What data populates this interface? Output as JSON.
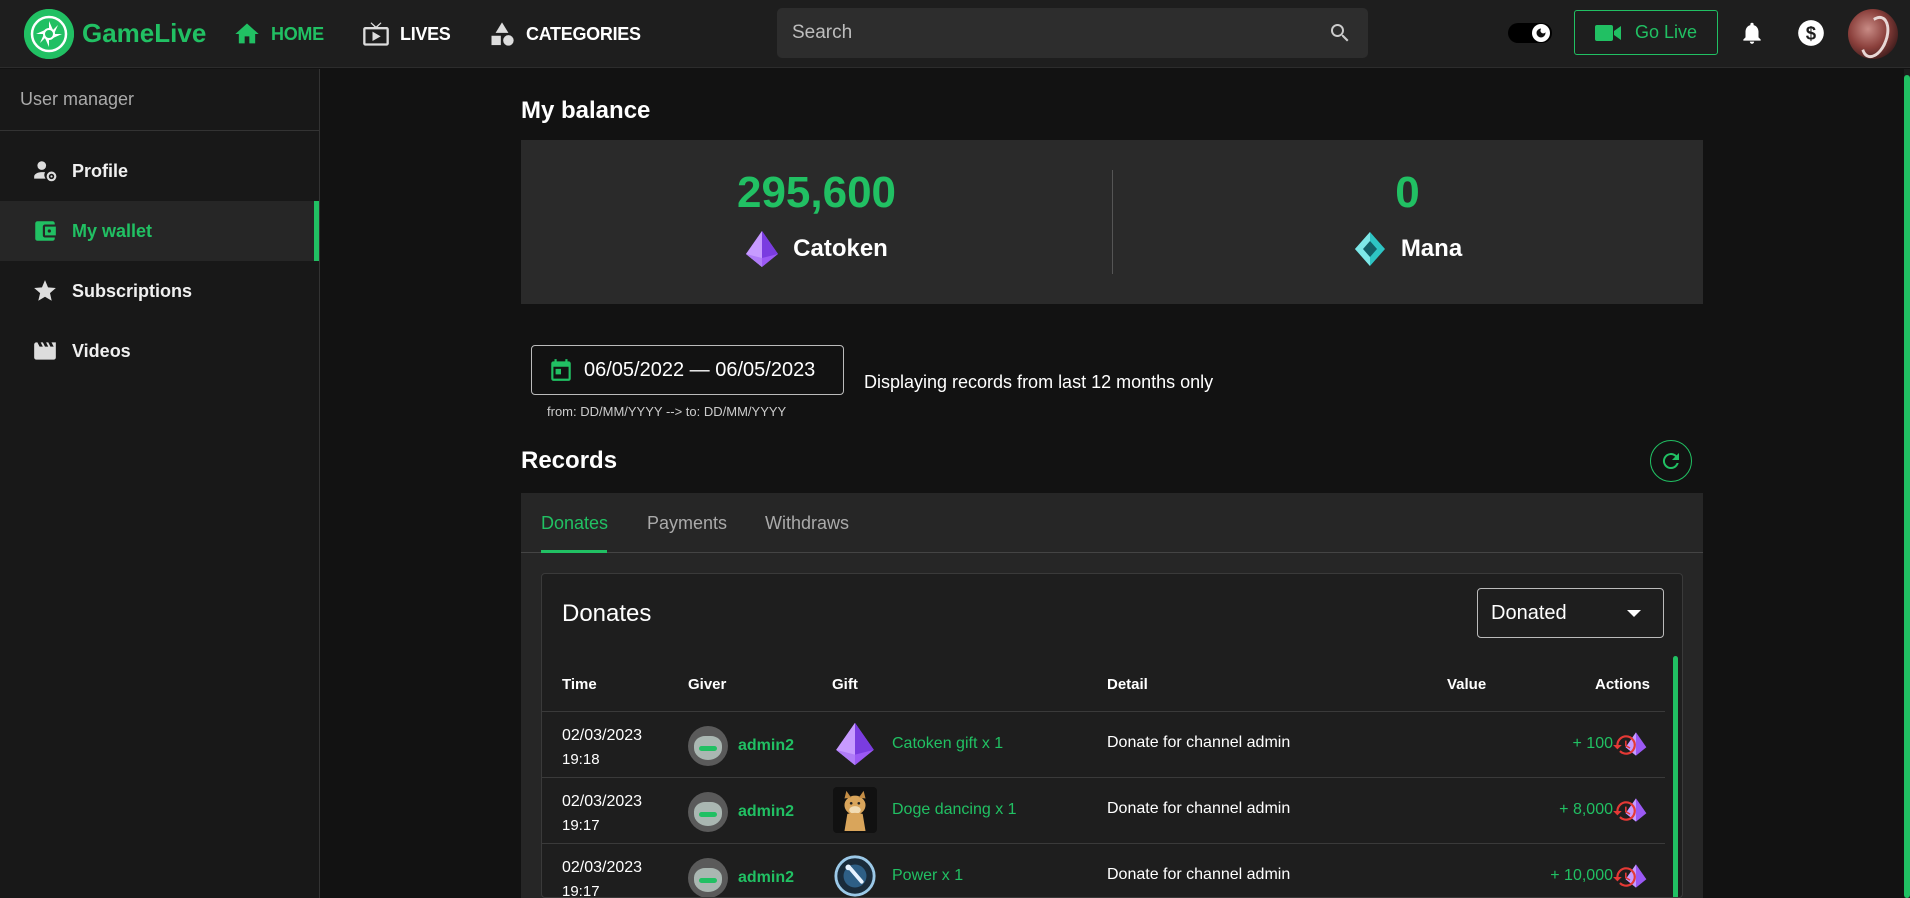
{
  "app": {
    "name": "GameLive"
  },
  "nav": [
    {
      "label": "HOME",
      "icon": "home-icon",
      "active": true
    },
    {
      "label": "LIVES",
      "icon": "tv-icon",
      "active": false
    },
    {
      "label": "CATEGORIES",
      "icon": "shapes-icon",
      "active": false
    }
  ],
  "search": {
    "placeholder": "Search",
    "value": ""
  },
  "header": {
    "go_live_label": "Go Live"
  },
  "colors": {
    "accent": "#21c063",
    "danger": "#e53935",
    "catoken": "#a855f7",
    "mana": "#2ec4c4"
  },
  "sidebar": {
    "heading": "User manager",
    "items": [
      {
        "label": "Profile",
        "icon": "user-gear-icon",
        "active": false
      },
      {
        "label": "My wallet",
        "icon": "wallet-icon",
        "active": true
      },
      {
        "label": "Subscriptions",
        "icon": "star-icon",
        "active": false
      },
      {
        "label": "Videos",
        "icon": "clapperboard-icon",
        "active": false
      }
    ]
  },
  "balance": {
    "title": "My balance",
    "catoken": {
      "amount": "295,600",
      "label": "Catoken"
    },
    "mana": {
      "amount": "0",
      "label": "Mana"
    }
  },
  "date_filter": {
    "value": "06/05/2022 — 06/05/2023",
    "hint": "from: DD/MM/YYYY --> to: DD/MM/YYYY",
    "note": "Displaying records from last 12 months only"
  },
  "records": {
    "title": "Records",
    "tabs": [
      "Donates",
      "Payments",
      "Withdraws"
    ],
    "active_tab": "Donates"
  },
  "donates": {
    "title": "Donates",
    "filter_value": "Donated",
    "columns": [
      "Time",
      "Giver",
      "Gift",
      "Detail",
      "Value",
      "Actions"
    ],
    "rows": [
      {
        "date": "02/03/2023",
        "time": "19:18",
        "giver": "admin2",
        "gift": "Catoken gift x 1",
        "gift_icon": "catoken-gem-icon",
        "detail": "Donate for channel admin",
        "value": "+ 100"
      },
      {
        "date": "02/03/2023",
        "time": "19:17",
        "giver": "admin2",
        "gift": "Doge dancing x 1",
        "gift_icon": "doge-icon",
        "detail": "Donate for channel admin",
        "value": "+ 8,000"
      },
      {
        "date": "02/03/2023",
        "time": "19:17",
        "giver": "admin2",
        "gift": "Power x 1",
        "gift_icon": "power-orb-icon",
        "detail": "Donate for channel admin",
        "value": "+ 10,000"
      }
    ]
  }
}
